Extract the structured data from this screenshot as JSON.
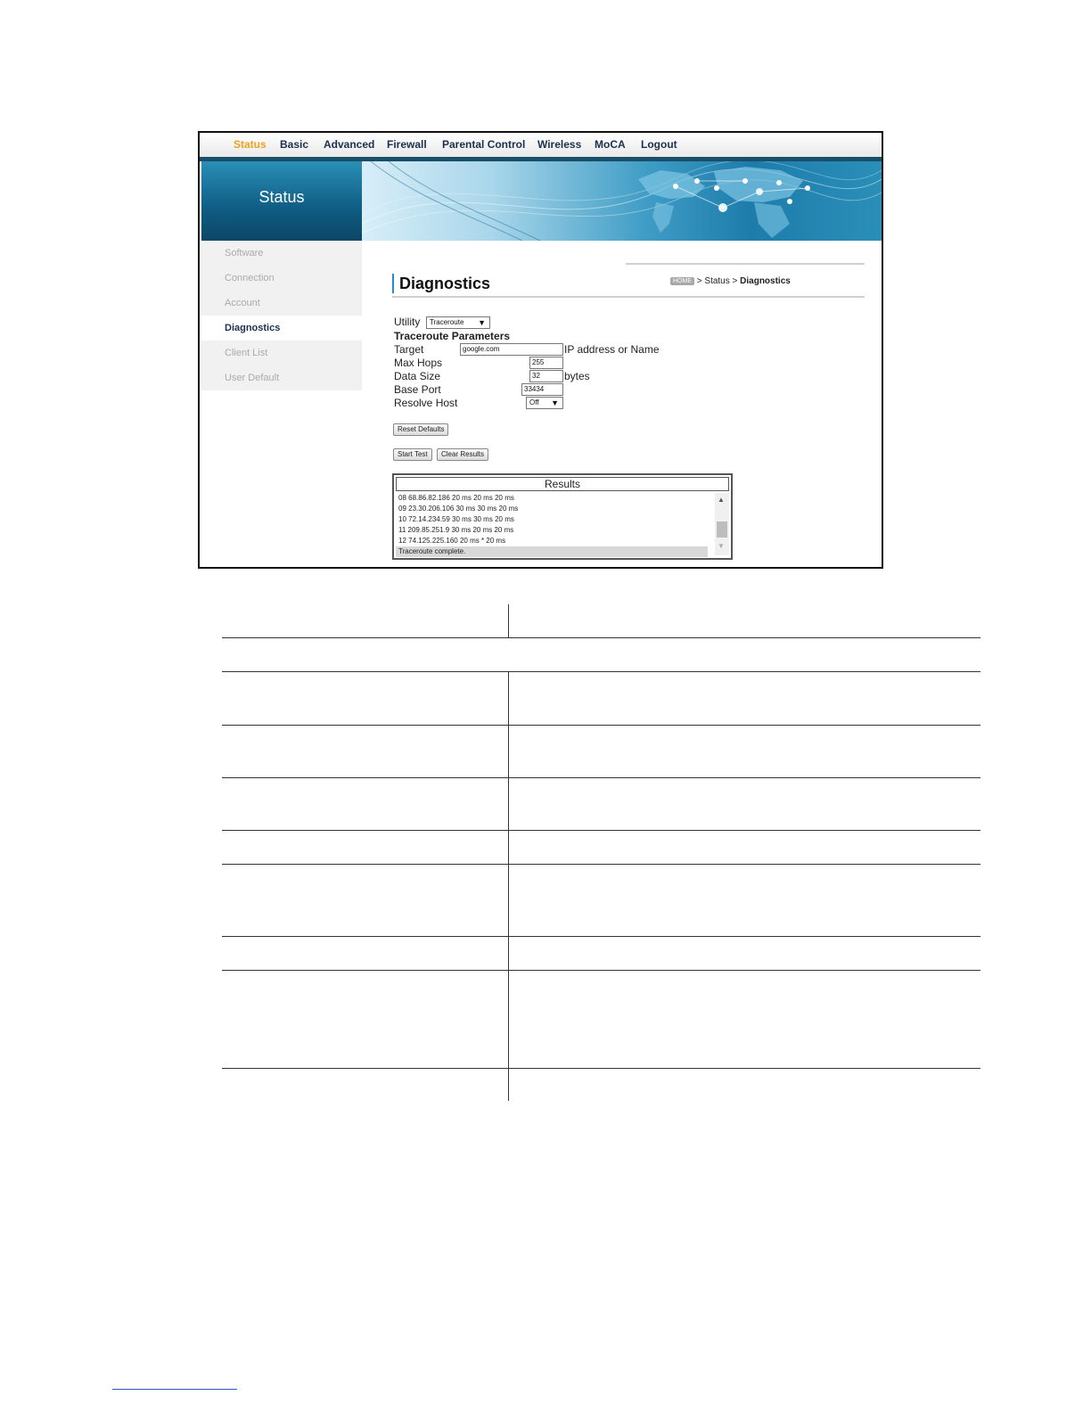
{
  "nav": {
    "items": [
      "Status",
      "Basic",
      "Advanced",
      "Firewall",
      "Parental Control",
      "Wireless",
      "MoCA",
      "Logout"
    ],
    "active": "Status",
    "active_color": "#f0a020"
  },
  "banner": {
    "section_title": "Status"
  },
  "sidebar": {
    "items": [
      {
        "label": "Software"
      },
      {
        "label": "Connection"
      },
      {
        "label": "Account"
      },
      {
        "label": "Diagnostics",
        "active": true
      },
      {
        "label": "Client List"
      },
      {
        "label": "User Default"
      }
    ]
  },
  "page": {
    "title": "Diagnostics",
    "breadcrumb": {
      "home": "HOME",
      "sep1": " > Status > ",
      "current": "Diagnostics"
    }
  },
  "form": {
    "utility_label": "Utility",
    "utility_value": "Traceroute",
    "section_heading": "Traceroute Parameters",
    "target_label": "Target",
    "target_value": "google.com",
    "target_hint": "IP address or Name",
    "max_hops_label": "Max Hops",
    "max_hops_value": "255",
    "data_size_label": "Data Size",
    "data_size_value": "32",
    "data_size_unit": "bytes",
    "base_port_label": "Base Port",
    "base_port_value": "33434",
    "resolve_host_label": "Resolve Host",
    "resolve_host_value": "Off",
    "reset_defaults": "Reset Defaults",
    "start_test": "Start Test",
    "clear_results": "Clear Results"
  },
  "results": {
    "header": "Results",
    "lines": [
      "08 68.86.82.186 20 ms 20 ms 20 ms",
      "09 23.30.206.106 30 ms 30 ms 20 ms",
      "10 72.14.234.59 30 ms 30 ms 20 ms",
      "11 209.85.251.9 30 ms 20 ms 20 ms",
      "12 74.125.225.160 20 ms * 20 ms",
      "Traceroute complete."
    ]
  }
}
